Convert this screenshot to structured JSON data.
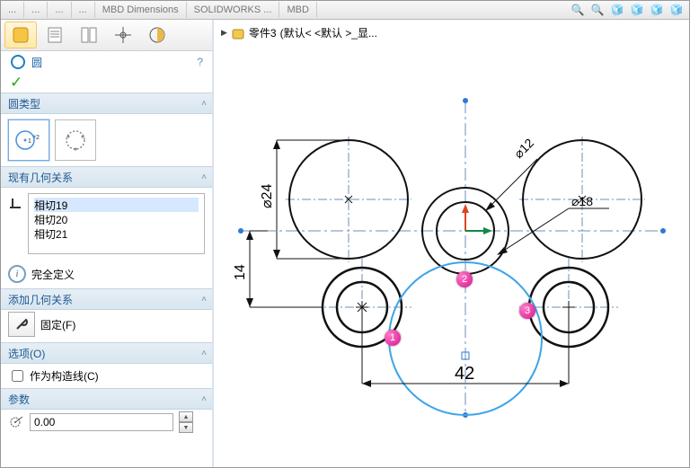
{
  "header": {
    "tabs": [
      "...",
      "...",
      "...",
      "...",
      "MBD Dimensions",
      "SOLIDWORKS ...",
      "MBD"
    ]
  },
  "breadcrumb": {
    "part": "零件3",
    "state": "(默认< <默认 >_显..."
  },
  "tool": {
    "name": "圆",
    "help_glyph": "?",
    "ok_glyph": "✓"
  },
  "sections": {
    "circle_type": "圆类型",
    "existing_relations": "现有几何关系",
    "add_relations": "添加几何关系",
    "options": "选项(O)",
    "parameters": "参数"
  },
  "relations": {
    "items": [
      "相切19",
      "相切20",
      "相切21"
    ],
    "status": "完全定义"
  },
  "add": {
    "fix_label": "固定(F)"
  },
  "options": {
    "construction_label": "作为构造线(C)",
    "construction_checked": false
  },
  "params": {
    "value": "0.00"
  },
  "sketch": {
    "dims": {
      "d24": "⌀24",
      "d12": "⌀12",
      "d18": "⌀18",
      "h14": "14",
      "w42": "42"
    },
    "markers": [
      "1",
      "2",
      "3"
    ]
  }
}
